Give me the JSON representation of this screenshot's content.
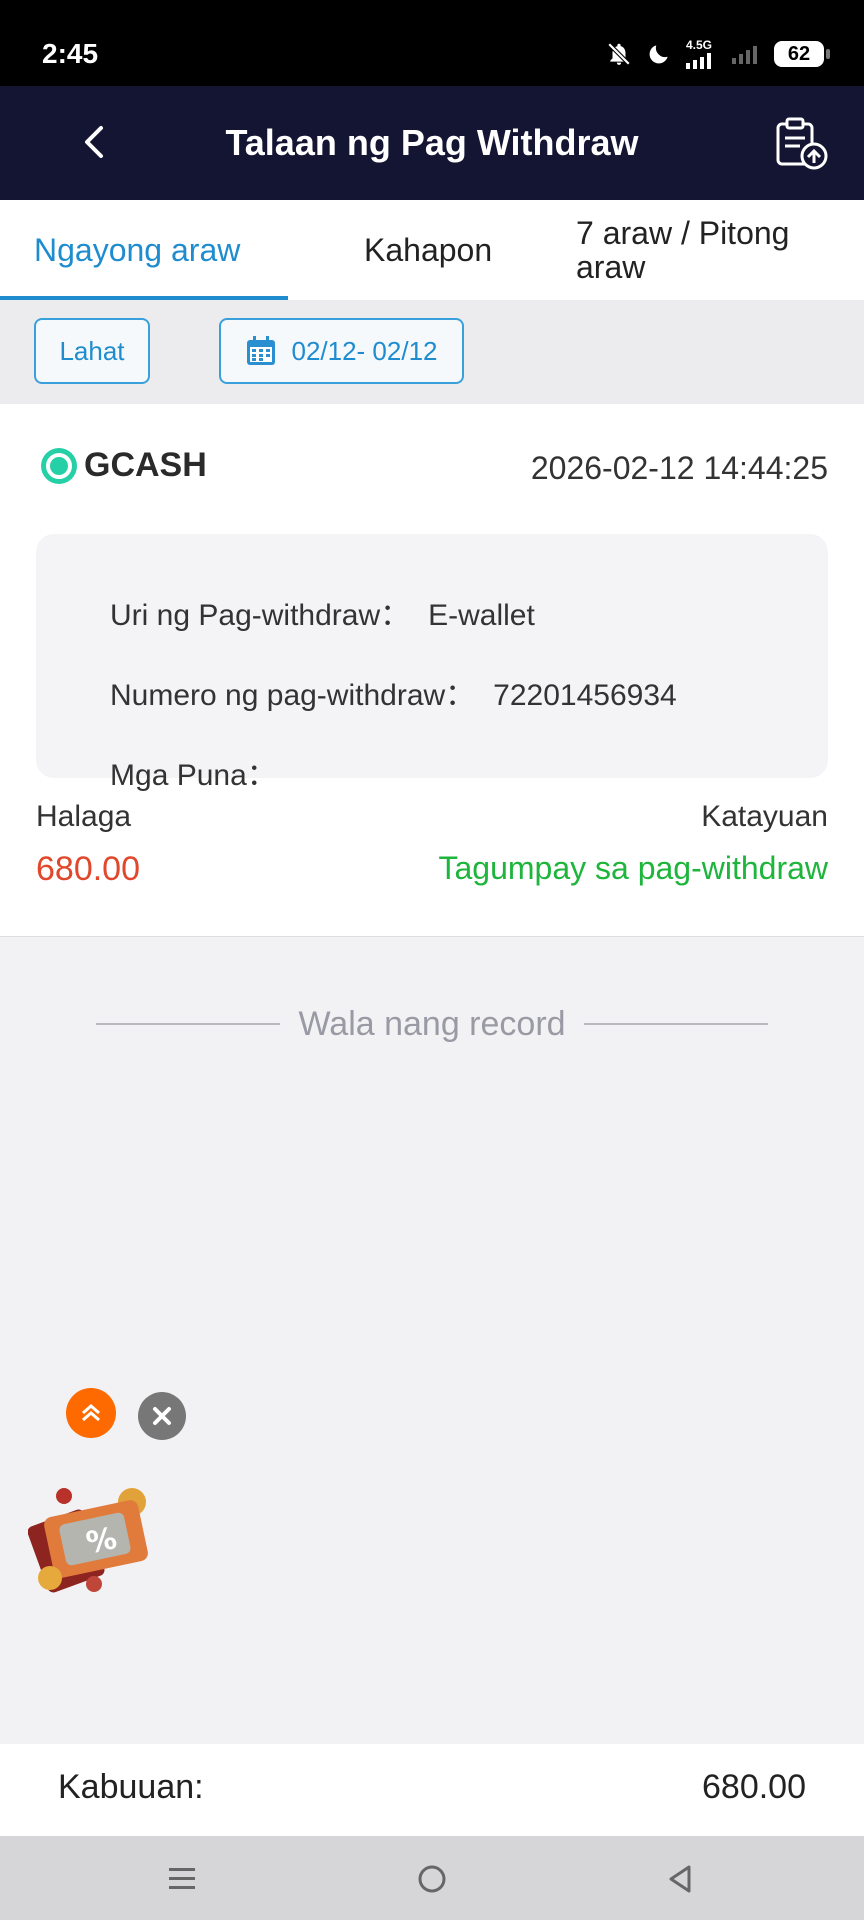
{
  "status_bar": {
    "time": "2:45",
    "network": "4.5G",
    "battery": "62"
  },
  "header": {
    "title": "Talaan ng Pag Withdraw"
  },
  "tabs": [
    {
      "label": "Ngayong araw",
      "active": true
    },
    {
      "label": "Kahapon",
      "active": false
    },
    {
      "label": "7 araw / Pitong araw",
      "active": false
    }
  ],
  "filters": {
    "all_label": "Lahat",
    "date_range": "02/12- 02/12"
  },
  "record": {
    "brand": "GCASH",
    "datetime": "2026-02-12 14:44:25",
    "details": [
      {
        "label": "Uri ng Pag-withdraw：",
        "value": "E-wallet"
      },
      {
        "label": "Numero ng pag-withdraw：",
        "value": "72201456934"
      },
      {
        "label": "Mga Puna：",
        "value": ""
      }
    ],
    "amount_label": "Halaga",
    "amount": "680.00",
    "status_label": "Katayuan",
    "status": "Tagumpay sa pag-withdraw"
  },
  "no_more_records": "Wala nang record",
  "total": {
    "label": "Kabuuan:",
    "value": "680.00"
  },
  "colors": {
    "accent": "#1e8ccf",
    "header_bg": "#141433",
    "amount": "#e0472b",
    "success": "#1db53b"
  }
}
